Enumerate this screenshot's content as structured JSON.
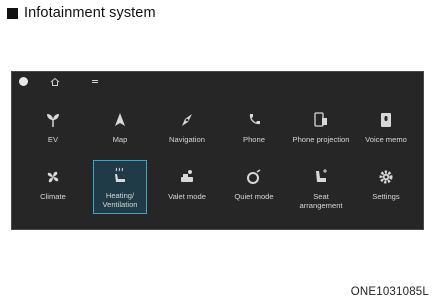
{
  "heading": {
    "title": "Infotainment system"
  },
  "screen": {
    "topbar": {
      "icons": [
        "brightness-icon",
        "home-icon",
        "menu-icon"
      ]
    },
    "apps_row1": [
      {
        "label": "EV",
        "icon": "plant-icon"
      },
      {
        "label": "Map",
        "icon": "arrow-icon"
      },
      {
        "label": "Navigation",
        "icon": "compass-icon"
      },
      {
        "label": "Phone",
        "icon": "phone-icon"
      },
      {
        "label": "Phone projection",
        "icon": "phone-projection-icon"
      },
      {
        "label": "Voice memo",
        "icon": "voice-memo-icon"
      }
    ],
    "apps_row2": [
      {
        "label": "Climate",
        "icon": "fan-icon"
      },
      {
        "label": "Heating/ Ventilation",
        "icon": "seat-heat-icon",
        "selected": true
      },
      {
        "label": "Valet mode",
        "icon": "valet-icon"
      },
      {
        "label": "Quiet mode",
        "icon": "quiet-icon"
      },
      {
        "label": "Seat arrangement",
        "icon": "seat-icon"
      },
      {
        "label": "Settings",
        "icon": "gear-icon"
      }
    ],
    "colors": {
      "background": "#262626",
      "selected_border": "#3ea6c4",
      "text": "#d6d6d6"
    }
  },
  "caption": {
    "code": "ONE1031085L"
  }
}
